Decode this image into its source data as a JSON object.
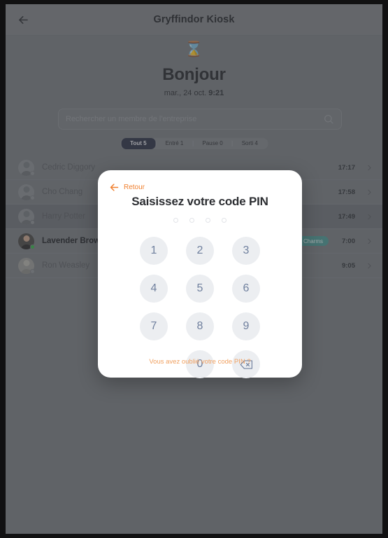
{
  "header": {
    "title": "Gryffindor Kiosk",
    "back_icon": "arrow-left-icon"
  },
  "greeting": {
    "icon": "hourglass-icon",
    "title": "Bonjour",
    "date_prefix": "mar., 24 oct. ",
    "time": "9:21"
  },
  "search": {
    "placeholder": "Rechercher un membre de l'entreprise",
    "value": "",
    "icon": "search-icon"
  },
  "filters": {
    "tabs": [
      {
        "label": "Tout 5",
        "active": true
      },
      {
        "label": "Entré 1",
        "active": false
      },
      {
        "label": "Pause 0",
        "active": false
      },
      {
        "label": "Sorti 4",
        "active": false
      }
    ]
  },
  "members": [
    {
      "name": "Cedric Diggory",
      "time": "17:17",
      "badge": "",
      "online": false,
      "highlighted": false,
      "bold": false
    },
    {
      "name": "Cho Chang",
      "time": "17:58",
      "badge": "",
      "online": false,
      "highlighted": false,
      "bold": false
    },
    {
      "name": "Harry Potter",
      "time": "17:49",
      "badge": "",
      "online": false,
      "highlighted": true,
      "bold": false
    },
    {
      "name": "Lavender Brown",
      "time": "7:00",
      "badge": "Charms",
      "online": true,
      "highlighted": false,
      "bold": true
    },
    {
      "name": "Ron Weasley",
      "time": "9:05",
      "badge": "",
      "online": false,
      "highlighted": false,
      "bold": false
    }
  ],
  "pin_modal": {
    "back_label": "Retour",
    "back_icon": "arrow-left-icon",
    "title": "Saisissez votre code PIN",
    "dots_total": 4,
    "dots_filled": 0,
    "keys": [
      "1",
      "2",
      "3",
      "4",
      "5",
      "6",
      "7",
      "8",
      "9",
      "",
      "0",
      "backspace-icon"
    ],
    "forgot_label": "Vous avez oublié votre code PIN ?"
  },
  "colors": {
    "accent_orange": "#f08030",
    "badge_teal": "#4f9a94",
    "online_green": "#39b54a",
    "tab_active": "#2f3448",
    "key_bg": "#eceef1",
    "key_text": "#70809e"
  }
}
